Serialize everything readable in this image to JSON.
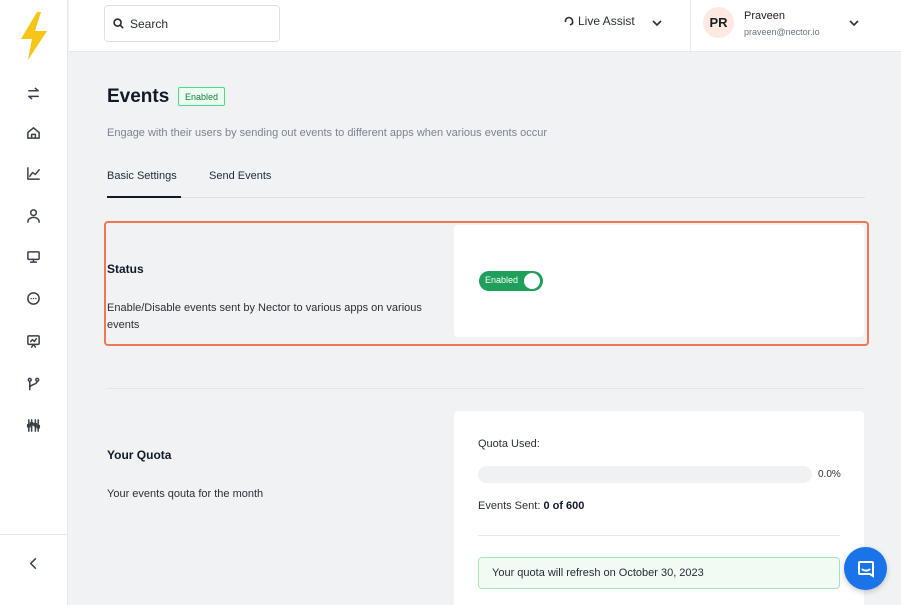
{
  "colors": {
    "accent": "#f07850",
    "toggle_on": "#1fa05a",
    "logo": "#f5c518",
    "chat": "#1a73e8"
  },
  "header": {
    "search_placeholder": "Search",
    "live_assist": "Live Assist",
    "user": {
      "initials": "PR",
      "name": "Praveen",
      "email": "praveen@nector.io"
    }
  },
  "sidebar": {
    "items": [
      {
        "icon": "swap-icon"
      },
      {
        "icon": "home-icon"
      },
      {
        "icon": "chart-icon"
      },
      {
        "icon": "user-icon"
      },
      {
        "icon": "monitor-icon"
      },
      {
        "icon": "chat-icon"
      },
      {
        "icon": "presentation-icon"
      },
      {
        "icon": "branch-icon"
      },
      {
        "icon": "sliders-icon"
      }
    ],
    "collapse_icon": "chevron-left-icon"
  },
  "main": {
    "title": "Events",
    "badge": "Enabled",
    "subtitle": "Engage with their users by sending out events to different apps when various events occur",
    "tabs": [
      {
        "label": "Basic Settings"
      },
      {
        "label": "Send Events"
      }
    ],
    "status": {
      "title": "Status",
      "description": "Enable/Disable events sent by Nector to various apps on various events",
      "toggle_label": "Enabled",
      "enabled": true
    },
    "quota": {
      "title": "Your Quota",
      "description": "Your events qouta for the month",
      "used_label": "Quota Used:",
      "used_fraction": 0.0,
      "percent_text": "0.0%",
      "events_sent_label": "Events Sent:",
      "events_sent_value": "0 of 600",
      "refresh_note": "Your quota will refresh on October 30, 2023"
    }
  }
}
